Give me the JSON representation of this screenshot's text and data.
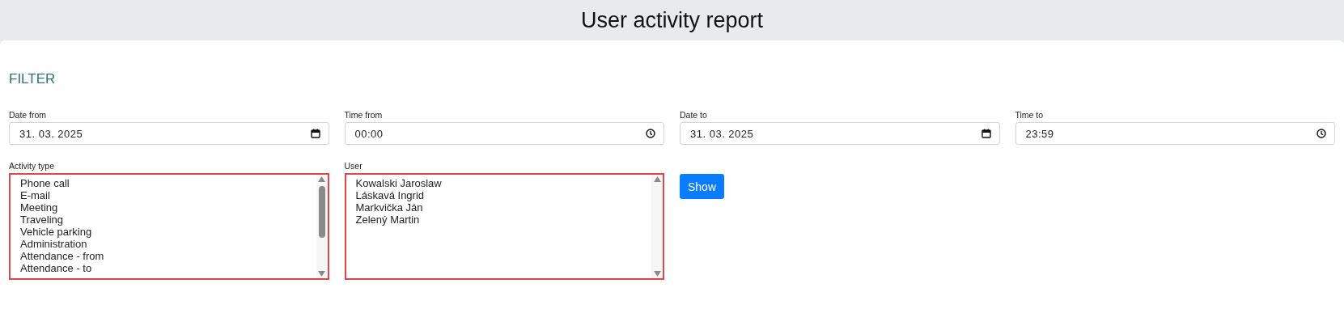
{
  "header": {
    "title": "User activity report"
  },
  "filter": {
    "heading": "FILTER",
    "fields": [
      {
        "kind": "date",
        "label": "Date from",
        "value": "31. 03. 2025"
      },
      {
        "kind": "time",
        "label": "Time from",
        "value": "00:00"
      },
      {
        "kind": "date",
        "label": "Date to",
        "value": "31. 03. 2025"
      },
      {
        "kind": "time",
        "label": "Time to",
        "value": "23:59"
      }
    ],
    "lists": [
      {
        "label": "Activity type",
        "invalid": true,
        "options": [
          {
            "label": "Phone call",
            "selected": false
          },
          {
            "label": "E-mail",
            "selected": false
          },
          {
            "label": "Meeting",
            "selected": false
          },
          {
            "label": "Traveling",
            "selected": false
          },
          {
            "label": "Vehicle parking",
            "selected": false
          },
          {
            "label": "Administration",
            "selected": false
          },
          {
            "label": "Attendance - from",
            "selected": false
          },
          {
            "label": "Attendance - to",
            "selected": false
          }
        ]
      },
      {
        "label": "User",
        "invalid": true,
        "options": [
          {
            "label": "Kowalski Jaroslaw",
            "selected": false
          },
          {
            "label": "Láskavá Ingrid",
            "selected": false
          },
          {
            "label": "Markvička Ján",
            "selected": false
          },
          {
            "label": "Zelený Martin",
            "selected": false
          }
        ]
      }
    ],
    "button": "Show"
  }
}
